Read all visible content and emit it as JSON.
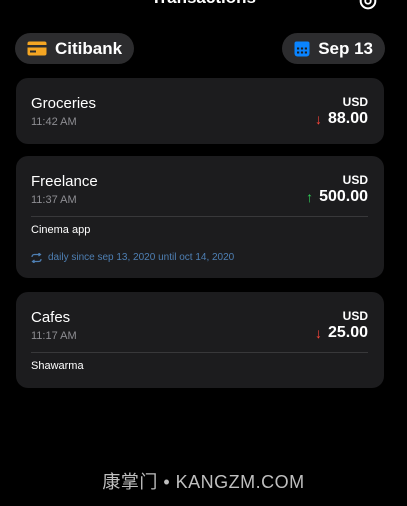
{
  "header": {
    "title": "Transactions"
  },
  "account": {
    "name": "Citibank",
    "icon": "credit-card-icon",
    "icon_color": "#f5a623"
  },
  "date_filter": {
    "label": "Sep 13",
    "icon": "calendar-icon",
    "icon_color": "#0a84ff"
  },
  "colors": {
    "down": "#ff453a",
    "up": "#30d158",
    "recurrence": "#4e7fb3"
  },
  "transactions": [
    {
      "title": "Groceries",
      "time": "11:42 AM",
      "currency": "USD",
      "direction": "down",
      "arrow": "↓",
      "amount": "88.00"
    },
    {
      "title": "Freelance",
      "time": "11:37 AM",
      "currency": "USD",
      "direction": "up",
      "arrow": "↑",
      "amount": "500.00",
      "note": "Cinema app",
      "recurrence": "daily since sep 13, 2020 until oct 14, 2020"
    },
    {
      "title": "Cafes",
      "time": "11:17 AM",
      "currency": "USD",
      "direction": "down",
      "arrow": "↓",
      "amount": "25.00",
      "note": "Shawarma"
    }
  ],
  "watermark": "康掌门 • KANGZM.COM"
}
